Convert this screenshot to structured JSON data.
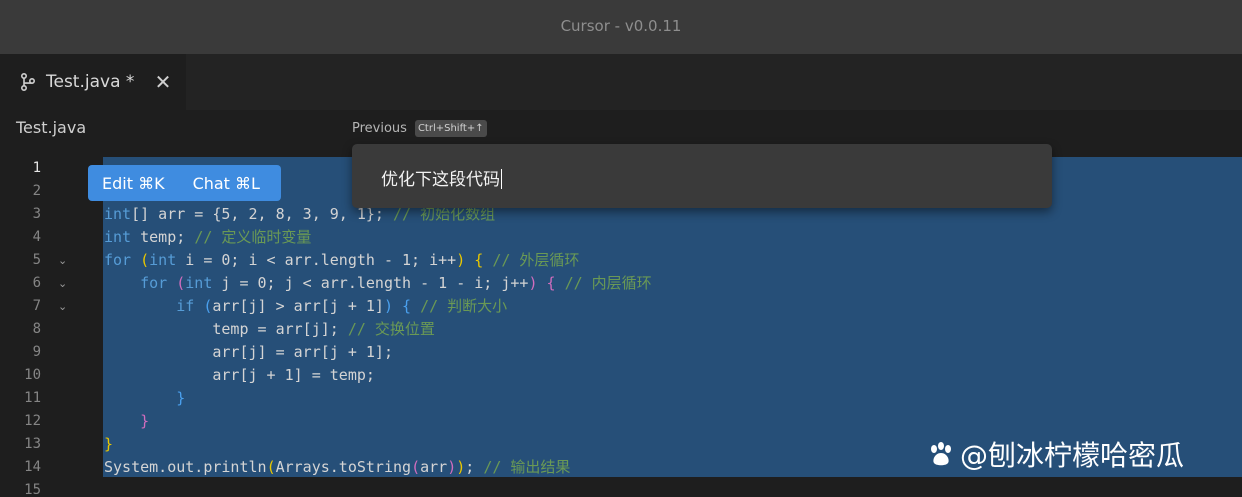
{
  "window": {
    "title": "Cursor - v0.0.11"
  },
  "tab": {
    "label": "Test.java *",
    "branch_icon": "source-branch-icon",
    "close_glyph": "✕"
  },
  "breadcrumb": "Test.java",
  "previous": {
    "label": "Previous",
    "shortcut": "Ctrl+Shift+↑"
  },
  "hover_actions": {
    "edit": "Edit ⌘K",
    "chat": "Chat ⌘L"
  },
  "prompt": {
    "value": "优化下这段代码"
  },
  "editor": {
    "active_line": 1,
    "lines": [
      {
        "n": "1",
        "text": ""
      },
      {
        "n": "2",
        "text": ""
      },
      {
        "n": "3",
        "text": "int[] arr = {5, 2, 8, 3, 9, 1}; // 初始化数组"
      },
      {
        "n": "4",
        "text": "int temp; // 定义临时变量"
      },
      {
        "n": "5",
        "text": "for (int i = 0; i < arr.length - 1; i++) { // 外层循环"
      },
      {
        "n": "6",
        "text": "    for (int j = 0; j < arr.length - 1 - i; j++) { // 内层循环"
      },
      {
        "n": "7",
        "text": "        if (arr[j] > arr[j + 1]) { // 判断大小"
      },
      {
        "n": "8",
        "text": "            temp = arr[j]; // 交换位置"
      },
      {
        "n": "9",
        "text": "            arr[j] = arr[j + 1];"
      },
      {
        "n": "10",
        "text": "            arr[j + 1] = temp;"
      },
      {
        "n": "11",
        "text": "        }"
      },
      {
        "n": "12",
        "text": "    }"
      },
      {
        "n": "13",
        "text": "}"
      },
      {
        "n": "14",
        "text": "System.out.println(Arrays.toString(arr)); // 输出结果"
      },
      {
        "n": "15",
        "text": ""
      }
    ]
  },
  "watermark": {
    "text": "@刨冰柠檬哈密瓜",
    "icon": "paw-icon"
  },
  "colors": {
    "selection": "#264f78",
    "accent": "#3f8ce0",
    "keyword": "#569cd6",
    "comment": "#6a9955"
  }
}
